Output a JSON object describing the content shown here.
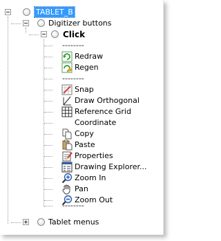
{
  "tree": {
    "root": {
      "label": "TABLET_B"
    },
    "digitizer": {
      "label": "Digitizer buttons"
    },
    "click": {
      "label": "Click"
    },
    "separator_text": "--------",
    "items": [
      {
        "label": "Redraw",
        "icon": "redraw-icon"
      },
      {
        "label": "Regen",
        "icon": "regen-icon"
      },
      {
        "label": "Snap",
        "icon": "snap-icon"
      },
      {
        "label": "Draw Orthogonal",
        "icon": "ortho-icon"
      },
      {
        "label": "Reference Grid",
        "icon": "grid-icon"
      },
      {
        "label": "Coordinate",
        "icon": ""
      },
      {
        "label": "Copy",
        "icon": "copy-icon"
      },
      {
        "label": "Paste",
        "icon": "paste-icon"
      },
      {
        "label": "Properties",
        "icon": "properties-icon"
      },
      {
        "label": "Drawing Explorer...",
        "icon": "drawing-explorer-icon"
      },
      {
        "label": "Zoom In",
        "icon": "zoom-in-icon"
      },
      {
        "label": "Pan",
        "icon": "pan-hand-icon"
      },
      {
        "label": "Zoom Out",
        "icon": "zoom-out-icon"
      }
    ],
    "tablet_menus": {
      "label": "Tablet menus"
    }
  },
  "colors": {
    "selection": "#3399ff",
    "redraw_green": "#2e9a2e",
    "snap_red": "#d03030",
    "zoom_blue": "#2f5fa8"
  }
}
